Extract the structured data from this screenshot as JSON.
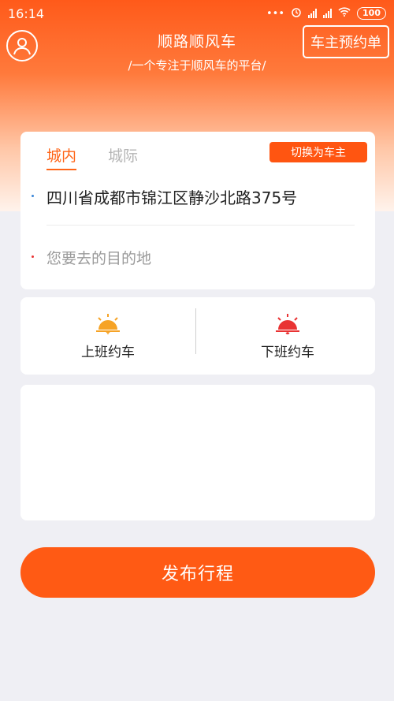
{
  "status_bar": {
    "time": "16:14",
    "battery": "100"
  },
  "header": {
    "title": "顺路顺风车",
    "subtitle": "/一个专注于顺风车的平台/",
    "owner_order_button": "车主预约单"
  },
  "route": {
    "tabs": [
      {
        "label": "城内",
        "active": true
      },
      {
        "label": "城际",
        "active": false
      }
    ],
    "switch_button": "切换为车主",
    "from_address": "四川省成都市锦江区静沙北路375号",
    "to_placeholder": "您要去的目的地"
  },
  "commute": {
    "morning_label": "上班约车",
    "evening_label": "下班约车"
  },
  "publish_button": "发布行程",
  "colors": {
    "accent": "#ff5a14",
    "sunrise": "#f6a326",
    "sunset": "#e93333"
  },
  "icons": {
    "avatar": "user-circle-icon",
    "sunrise": "sunrise-icon",
    "sunset": "sunset-icon"
  }
}
